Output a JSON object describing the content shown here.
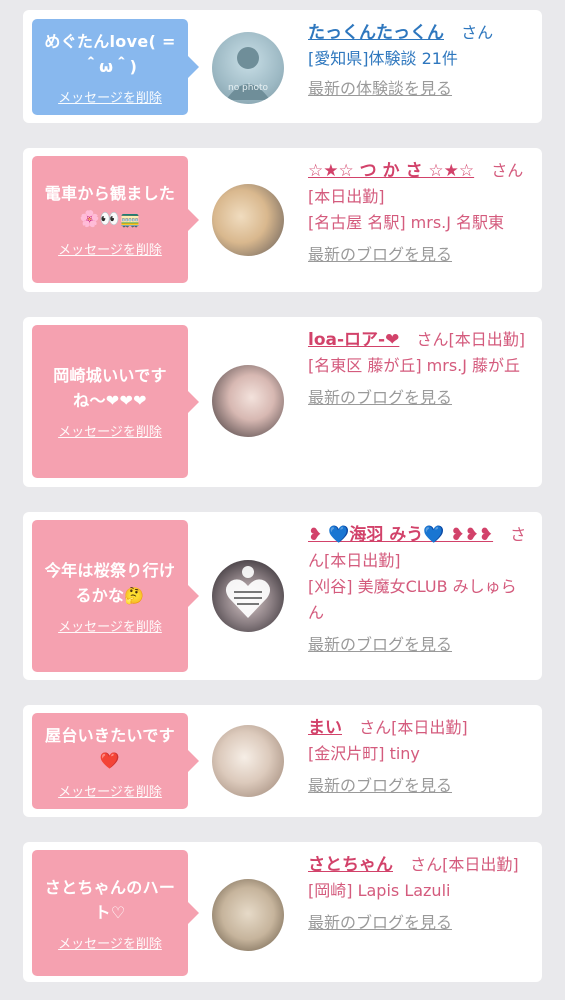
{
  "delete_label": "メッセージを削除",
  "san": "さん",
  "cards": [
    {
      "message": "めぐたんlove( =＾ω＾)",
      "name": "たっくんたっくん",
      "status": "",
      "shop": "[愛知県]体験談 21件",
      "link": "最新の体験談を見る",
      "theme": "blue"
    },
    {
      "message": "電車から観ました🌸👀🚃",
      "name": "☆★☆ つ か さ ☆★☆",
      "status": "[本日出勤]",
      "shop": "[名古屋 名駅] mrs.J 名駅東",
      "link": "最新のブログを見る",
      "theme": "pink"
    },
    {
      "message": "岡崎城いいですね〜❤❤❤",
      "name": "loa-ロア-❤",
      "status": "[本日出勤]",
      "shop": "[名東区 藤が丘] mrs.J 藤が丘",
      "link": "最新のブログを見る",
      "theme": "pink"
    },
    {
      "message": "今年は桜祭り行けるかな🤔",
      "name": "❥ 💙海羽 みう💙 ❥❥❥",
      "status": "[本日出勤]",
      "shop": "[刈谷] 美魔女CLUB みしゅらん",
      "link": "最新のブログを見る",
      "theme": "pink"
    },
    {
      "message": "屋台いきたいです❤️",
      "name": "まい",
      "status": "[本日出勤]",
      "shop": "[金沢片町] tiny",
      "link": "最新のブログを見る",
      "theme": "pink"
    },
    {
      "message": "さとちゃんのハート♡",
      "name": "さとちゃん",
      "status": "[本日出勤]",
      "shop": "[岡崎] Lapis Lazuli",
      "link": "最新のブログを見る",
      "theme": "pink"
    }
  ],
  "colors": {
    "blue_accent": "#2e77be",
    "pink_accent": "#d2426a",
    "bubble_blue": "#88b8ee",
    "bubble_pink": "#f5a1b0"
  },
  "avatar_0_placeholder": "no photo"
}
